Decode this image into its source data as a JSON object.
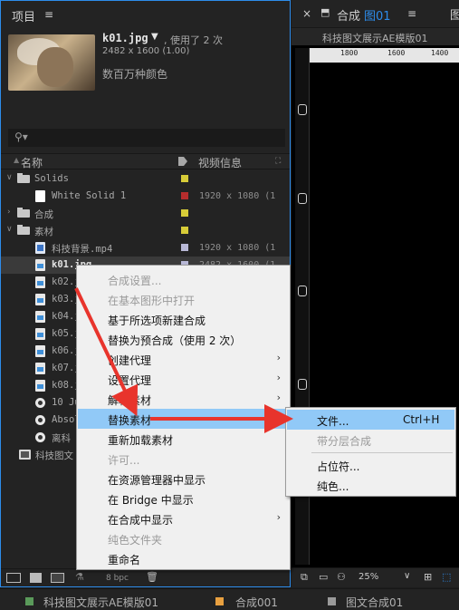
{
  "project_panel": {
    "title": "项目",
    "menu_icon": "≡",
    "file": {
      "name": "k01.jpg",
      "arrow": "▼",
      "used": ", 使用了 2 次",
      "dims": "2482 x 1600 (1.00)",
      "colors": "数百万种颜色"
    },
    "search_icon": "⚲▾",
    "columns": {
      "name": "名称",
      "info": "视频信息"
    },
    "rows": [
      {
        "name": "Solids",
        "twisty": "∨",
        "color": "#d7cc38",
        "info": ""
      },
      {
        "name": "White Solid 1",
        "twisty": "",
        "color": "#b52d2d",
        "info": "1920 x 1080 (1"
      },
      {
        "name": "合成",
        "twisty": "›",
        "color": "#d7cc38",
        "info": ""
      },
      {
        "name": "素材",
        "twisty": "∨",
        "color": "#d7cc38",
        "info": ""
      },
      {
        "name": "科技背景.mp4",
        "twisty": "",
        "color": "#b8b8d6",
        "info": "1920 x 1080 (1"
      },
      {
        "name": "k01.jpg",
        "twisty": "",
        "color": "#b8b8d6",
        "info": "2482 x 1600 (1"
      },
      {
        "name": "k02.j",
        "twisty": "",
        "color": "",
        "info": ""
      },
      {
        "name": "k03.j",
        "twisty": "",
        "color": "",
        "info": ""
      },
      {
        "name": "k04.j",
        "twisty": "",
        "color": "",
        "info": ""
      },
      {
        "name": "k05.j",
        "twisty": "",
        "color": "",
        "info": ""
      },
      {
        "name": "k06.j",
        "twisty": "",
        "color": "",
        "info": ""
      },
      {
        "name": "k07.j",
        "twisty": "",
        "color": "",
        "info": ""
      },
      {
        "name": "k08.j",
        "twisty": "",
        "color": "",
        "info": ""
      },
      {
        "name": "10 Ju",
        "twisty": "",
        "color": "",
        "info": ""
      },
      {
        "name": "Absol",
        "twisty": "",
        "color": "",
        "info": ""
      },
      {
        "name": "离科",
        "twisty": "",
        "color": "",
        "info": ""
      },
      {
        "name": "科技图文",
        "twisty": "",
        "color": "",
        "info": ""
      }
    ],
    "footer": {
      "bpc": "8 bpc"
    }
  },
  "comp_panel": {
    "close": "×",
    "lock_icon": "🔒",
    "tab_label": "合成",
    "tab_name": "图01",
    "menu_icon": "≡",
    "extra": "图",
    "breadcrumb": "科技图文展示AE模版01",
    "ruler": [
      "1800",
      "1600",
      "1400"
    ],
    "zoom": "25%"
  },
  "context_menu": {
    "items": [
      {
        "label": "合成设置...",
        "disabled": true,
        "submenu": false
      },
      {
        "label": "在基本图形中打开",
        "disabled": true,
        "submenu": false
      },
      {
        "label": "基于所选项新建合成",
        "disabled": false,
        "submenu": false
      },
      {
        "label": "替换为预合成（使用 2 次）",
        "disabled": false,
        "submenu": false
      },
      {
        "label": "创建代理",
        "disabled": false,
        "submenu": true
      },
      {
        "label": "设置代理",
        "disabled": false,
        "submenu": true
      },
      {
        "label": "解释素材",
        "disabled": false,
        "submenu": true
      },
      {
        "label": "替换素材",
        "disabled": false,
        "submenu": true,
        "highlighted": true
      },
      {
        "label": "重新加载素材",
        "disabled": false,
        "submenu": false
      },
      {
        "label": "许可...",
        "disabled": true,
        "submenu": false
      },
      {
        "label": "在资源管理器中显示",
        "disabled": false,
        "submenu": false
      },
      {
        "label": "在 Bridge 中显示",
        "disabled": false,
        "submenu": false
      },
      {
        "label": "在合成中显示",
        "disabled": false,
        "submenu": true
      },
      {
        "label": "纯色文件夹",
        "disabled": true,
        "submenu": false
      },
      {
        "label": "重命名",
        "disabled": false,
        "submenu": false
      }
    ]
  },
  "submenu": {
    "items": [
      {
        "label": "文件...",
        "shortcut": "Ctrl+H",
        "disabled": false,
        "highlighted": true
      },
      {
        "label": "带分层合成",
        "shortcut": "",
        "disabled": true
      },
      {
        "label": "占位符...",
        "shortcut": "",
        "disabled": false
      },
      {
        "label": "纯色...",
        "shortcut": "",
        "disabled": false
      }
    ]
  },
  "timeline_tabs": [
    {
      "label": "科技图文展示AE模版01",
      "color": "#5a9a5a"
    },
    {
      "label": "合成001",
      "color": "#e8a040"
    },
    {
      "label": "图文合成01",
      "color": "#9a9a9a"
    }
  ],
  "colors": {
    "accent": "#2d8ceb",
    "arrow": "#e8342c",
    "menu_highlight": "#91c9f7"
  }
}
